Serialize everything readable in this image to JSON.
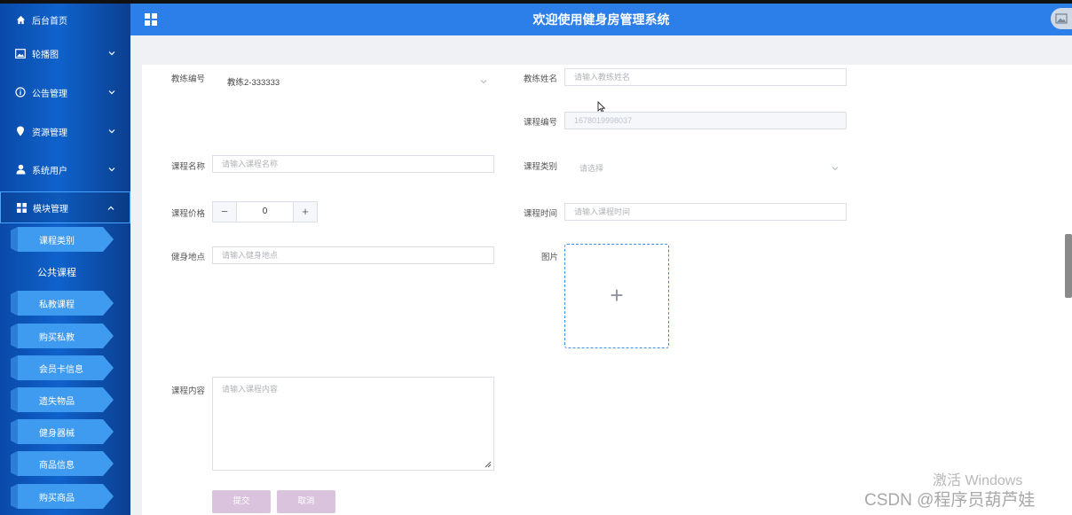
{
  "header": {
    "title": "欢迎使用健身房管理系统"
  },
  "sidebar": {
    "items": [
      {
        "label": "后台首页",
        "icon": "home-icon"
      },
      {
        "label": "轮播图",
        "icon": "image-icon"
      },
      {
        "label": "公告管理",
        "icon": "info-circle-icon"
      },
      {
        "label": "资源管理",
        "icon": "location-pin-icon"
      },
      {
        "label": "系统用户",
        "icon": "user-icon"
      },
      {
        "label": "模块管理",
        "icon": "grid-icon"
      }
    ],
    "submenu": [
      {
        "label": "课程类别"
      },
      {
        "label": "公共课程"
      },
      {
        "label": "私教课程"
      },
      {
        "label": "购买私教"
      },
      {
        "label": "会员卡信息"
      },
      {
        "label": "遗失物品"
      },
      {
        "label": "健身器械"
      },
      {
        "label": "商品信息"
      },
      {
        "label": "购买商品"
      }
    ]
  },
  "form": {
    "coach_no": {
      "label": "教练编号",
      "value": "教练2-333333"
    },
    "coach_name": {
      "label": "教练姓名",
      "placeholder": "请输入教练姓名"
    },
    "course_no": {
      "label": "课程编号",
      "value": "1678019998037"
    },
    "course_name": {
      "label": "课程名称",
      "placeholder": "请输入课程名称"
    },
    "course_type": {
      "label": "课程类别",
      "placeholder": "请选择"
    },
    "course_price": {
      "label": "课程价格",
      "value": "0",
      "minus": "−",
      "plus": "+"
    },
    "course_time": {
      "label": "课程时间",
      "placeholder": "请输入课程时间"
    },
    "location": {
      "label": "健身地点",
      "placeholder": "请输入健身地点"
    },
    "picture": {
      "label": "图片",
      "plus": "+"
    },
    "content": {
      "label": "课程内容",
      "placeholder": "请输入课程内容"
    },
    "submit": "提交",
    "cancel": "取消"
  },
  "watermarks": {
    "os": "激活 Windows",
    "site": "CSDN @程序员葫芦娃"
  },
  "colors": {
    "sidebar": "#0f62cc",
    "header": "#2c7fe8",
    "button": "#d9c3dd"
  }
}
